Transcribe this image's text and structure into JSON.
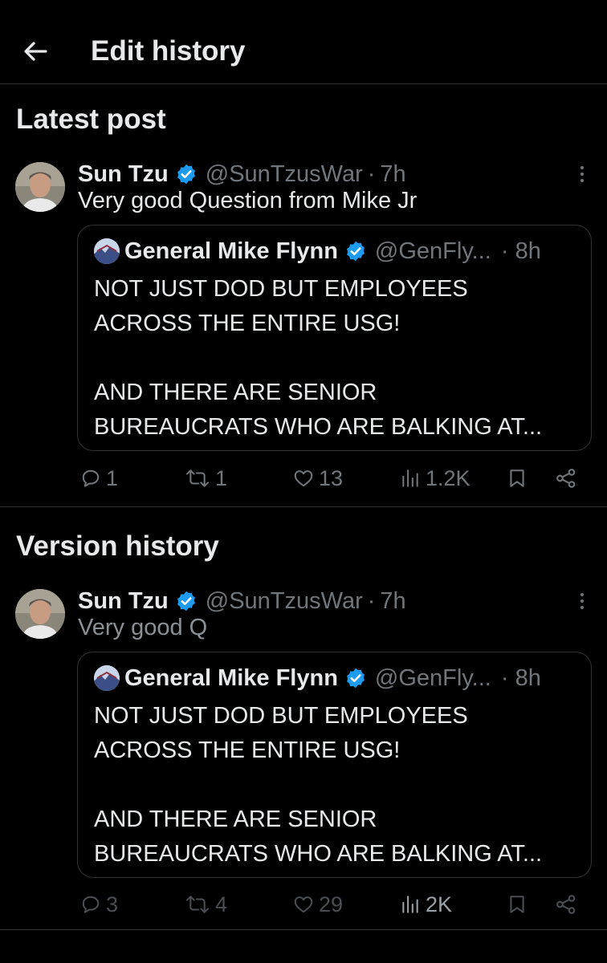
{
  "header": {
    "title": "Edit history"
  },
  "sections": {
    "latest": "Latest post",
    "history": "Version history"
  },
  "posts": [
    {
      "author": "Sun Tzu",
      "handle": "@SunTzusWar",
      "dot": "·",
      "time": "7h",
      "text": "Very good Question from Mike Jr",
      "quote": {
        "author": "General Mike Flynn",
        "handle": "@GenFly...",
        "time": "· 8h",
        "para1": "NOT JUST DOD BUT EMPLOYEES\nACROSS THE ENTIRE USG!",
        "para2": "AND THERE ARE SENIOR\nBUREAUCRATS WHO ARE BALKING AT..."
      },
      "stats": {
        "replies": "1",
        "reposts": "1",
        "likes": "13",
        "views": "1.2K"
      }
    },
    {
      "author": "Sun Tzu",
      "handle": "@SunTzusWar",
      "dot": "·",
      "time": "7h",
      "text": "Very good Q",
      "quote": {
        "author": "General Mike Flynn",
        "handle": "@GenFly...",
        "time": "· 8h",
        "para1": "NOT JUST DOD BUT EMPLOYEES\nACROSS THE ENTIRE USG!",
        "para2": "AND THERE ARE SENIOR\nBUREAUCRATS WHO ARE BALKING AT..."
      },
      "stats": {
        "replies": "3",
        "reposts": "4",
        "likes": "29",
        "views": "2K"
      }
    }
  ],
  "icons": {
    "back": "arrow-left-icon",
    "verified": "verified-badge-icon",
    "more": "more-vertical-icon",
    "reply": "reply-icon",
    "repost": "repost-icon",
    "like": "heart-icon",
    "views": "views-icon",
    "bookmark": "bookmark-icon",
    "share": "share-icon"
  },
  "colors": {
    "background": "#000000",
    "text": "#e7e9ea",
    "muted": "#71767b",
    "verified": "#1d9bf0",
    "border": "#2f3336"
  }
}
